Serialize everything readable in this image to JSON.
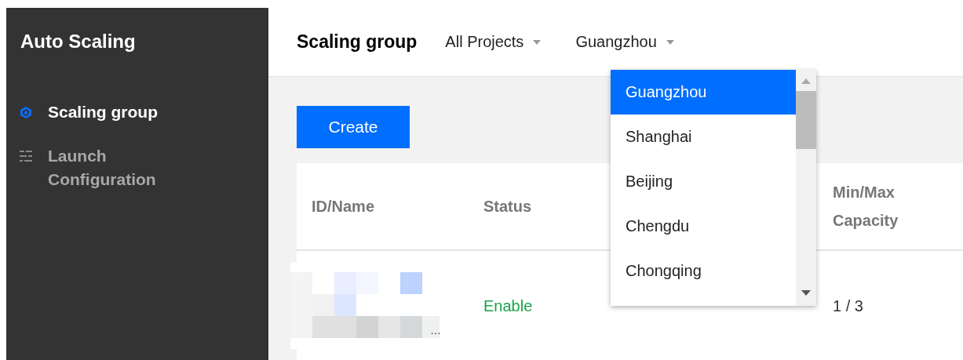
{
  "sidebar": {
    "title": "Auto Scaling",
    "items": [
      {
        "label": "Scaling group",
        "kind": "cube",
        "selected": true
      },
      {
        "label": "Launch Configuration",
        "kind": "sliders",
        "selected": false
      }
    ]
  },
  "header": {
    "title": "Scaling group",
    "filters": [
      {
        "label": "All Projects"
      },
      {
        "label": "Guangzhou"
      }
    ]
  },
  "create_button": "Create",
  "table": {
    "columns": [
      "ID/Name",
      "Status",
      "Min/Max Capacity"
    ],
    "rows": [
      {
        "name": {
          "kind": "picture",
          "suffix": "…"
        },
        "status": {
          "label": "Enable",
          "kind": "enabled"
        },
        "capacity": "1 / 3"
      }
    ]
  },
  "region_dropdown": {
    "options": [
      {
        "label": "Guangzhou",
        "selected": true
      },
      {
        "label": "Shanghai",
        "selected": false
      },
      {
        "label": "Beijing",
        "selected": false
      },
      {
        "label": "Chengdu",
        "selected": false
      },
      {
        "label": "Chongqing",
        "selected": false
      }
    ]
  }
}
